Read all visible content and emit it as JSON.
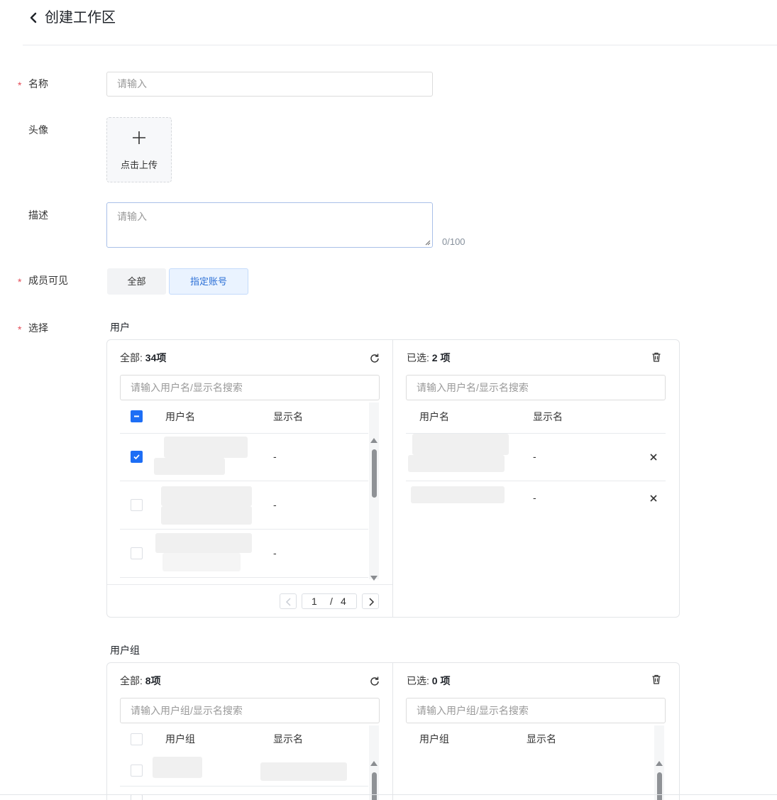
{
  "header": {
    "title": "创建工作区"
  },
  "form": {
    "name": {
      "label": "名称",
      "placeholder": "请输入"
    },
    "avatar": {
      "label": "头像",
      "upload_text": "点击上传"
    },
    "description": {
      "label": "描述",
      "placeholder": "请输入",
      "counter": "0/100"
    },
    "visibility": {
      "label": "成员可见",
      "options": [
        "全部",
        "指定账号"
      ],
      "selected": "指定账号"
    },
    "select": {
      "label": "选择"
    },
    "required_mark": "*"
  },
  "users": {
    "title": "用户",
    "left": {
      "head_label": "全部:",
      "head_count": "34项",
      "search_placeholder": "请输入用户名/显示名搜索",
      "col_username": "用户名",
      "col_display": "显示名",
      "rows": [
        {
          "checked": true,
          "display": "-"
        },
        {
          "checked": false,
          "display": "-"
        },
        {
          "checked": false,
          "display": "-"
        }
      ],
      "pager": {
        "current": "1",
        "separator": "/",
        "total": "4"
      }
    },
    "right": {
      "head_label": "已选:",
      "head_count": "2 项",
      "search_placeholder": "请输入用户名/显示名搜索",
      "col_username": "用户名",
      "col_display": "显示名",
      "rows": [
        {
          "display": "-"
        },
        {
          "display": "-"
        }
      ]
    }
  },
  "groups": {
    "title": "用户组",
    "left": {
      "head_label": "全部:",
      "head_count": "8项",
      "search_placeholder": "请输入用户组/显示名搜索",
      "col_group": "用户组",
      "col_display": "显示名"
    },
    "right": {
      "head_label": "已选:",
      "head_count": "0 项",
      "search_placeholder": "请输入用户组/显示名搜索",
      "col_group": "用户组",
      "col_display": "显示名"
    }
  },
  "colors": {
    "primary": "#1d6ef5",
    "required": "#e34d59",
    "selected_bg": "#eaf3ff"
  },
  "icons": [
    "back-chevron-icon",
    "plus-icon",
    "refresh-icon",
    "trash-icon",
    "close-icon",
    "chevron-left-icon",
    "chevron-right-icon",
    "check-icon",
    "indeterminate-icon"
  ]
}
